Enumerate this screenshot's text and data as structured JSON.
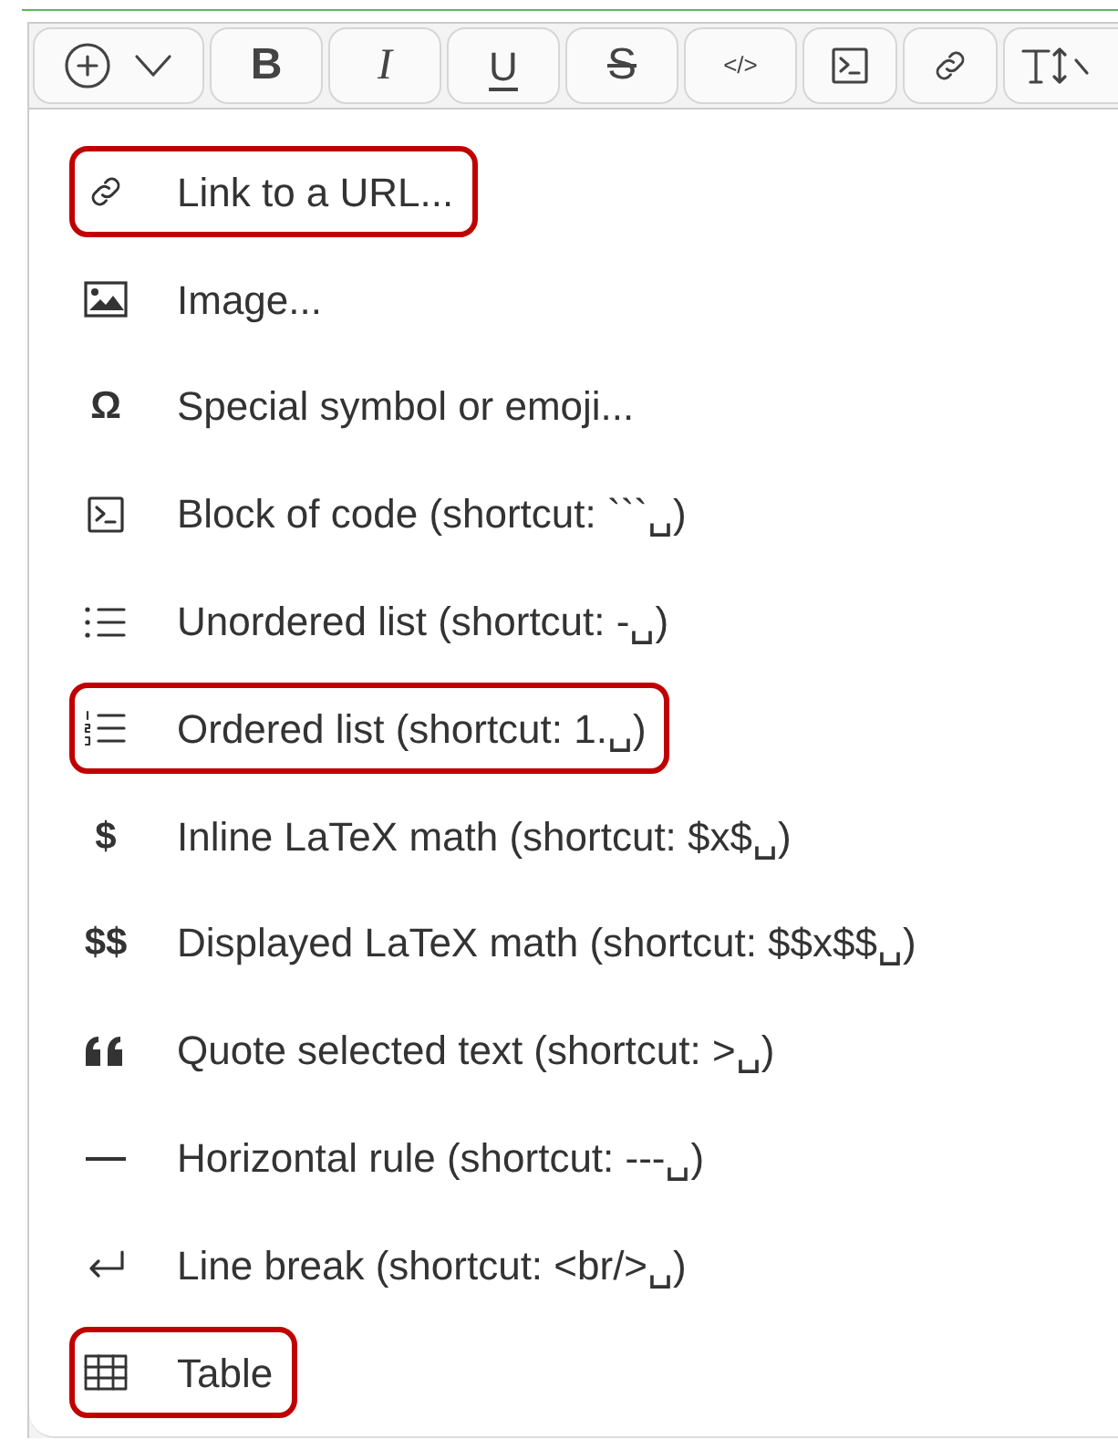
{
  "toolbar": [
    {
      "kind": "insert"
    },
    {
      "kind": "bold",
      "label": "B"
    },
    {
      "kind": "italic",
      "label": "I"
    },
    {
      "kind": "underline",
      "label": "U"
    },
    {
      "kind": "strike",
      "label": "S"
    },
    {
      "kind": "inline_code",
      "label": "</>"
    },
    {
      "kind": "terminal"
    },
    {
      "kind": "link"
    },
    {
      "kind": "size"
    }
  ],
  "menu": [
    {
      "kind": "link",
      "label": "Link to a URL...",
      "highlighted": true
    },
    {
      "kind": "image",
      "label": "Image...",
      "highlighted": false
    },
    {
      "kind": "glyph",
      "glyph": "Ω",
      "label": "Special symbol or emoji...",
      "highlighted": false
    },
    {
      "kind": "terminal",
      "label": "Block of code (shortcut: ```␣)",
      "highlighted": false
    },
    {
      "kind": "bullets",
      "label": "Unordered list (shortcut: -␣)",
      "highlighted": false
    },
    {
      "kind": "numbers",
      "label": "Ordered list (shortcut: 1.␣)",
      "highlighted": true
    },
    {
      "kind": "glyph",
      "glyph": "$",
      "label": "Inline LaTeX math (shortcut: $x$␣)",
      "highlighted": false
    },
    {
      "kind": "glyph",
      "glyph": "$$",
      "label": "Displayed LaTeX math (shortcut: $$x$$␣)",
      "highlighted": false
    },
    {
      "kind": "quote",
      "label": "Quote selected text (shortcut: >␣)",
      "highlighted": false
    },
    {
      "kind": "rule",
      "label": "Horizontal rule (shortcut: ---␣)",
      "highlighted": false
    },
    {
      "kind": "linebreak",
      "label": "Line break (shortcut: <br/>␣)",
      "highlighted": false
    },
    {
      "kind": "table",
      "label": "Table",
      "highlighted": true
    }
  ]
}
